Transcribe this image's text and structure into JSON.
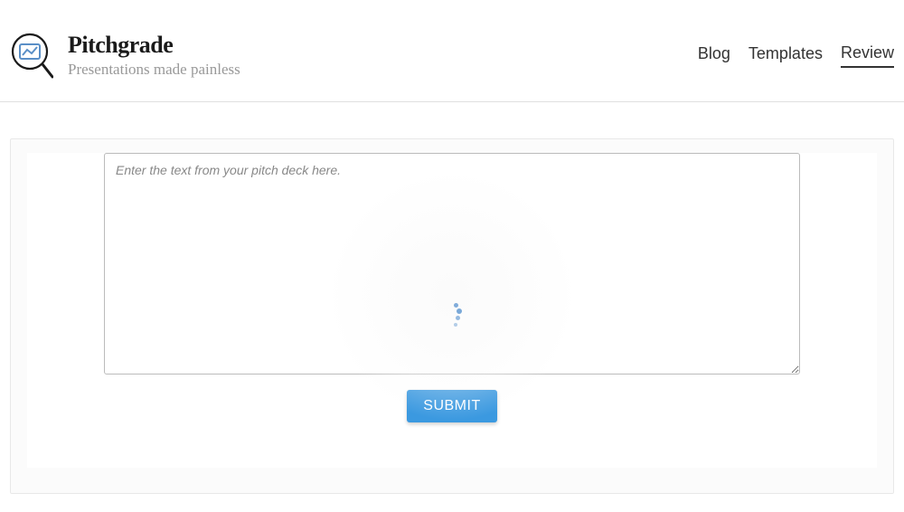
{
  "header": {
    "title": "Pitchgrade",
    "tagline": "Presentations made painless"
  },
  "nav": {
    "items": [
      {
        "label": "Blog",
        "active": false
      },
      {
        "label": "Templates",
        "active": false
      },
      {
        "label": "Review",
        "active": true
      }
    ]
  },
  "review": {
    "textarea": {
      "value": "",
      "placeholder": "Enter the text from your pitch deck here."
    },
    "submit_label": "SUBMIT",
    "loading": true
  },
  "colors": {
    "accent": "#3b99e0",
    "spinner": "#6a9ed4"
  }
}
